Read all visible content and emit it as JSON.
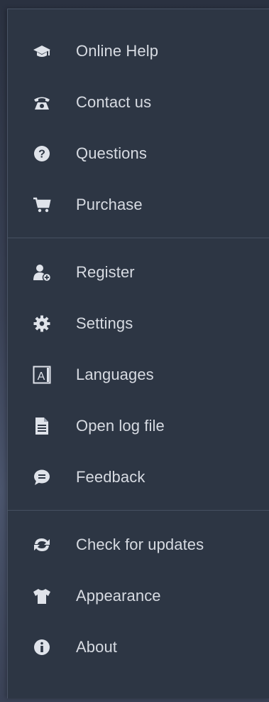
{
  "menu": {
    "groups": [
      {
        "items": [
          {
            "label": "Online Help",
            "icon": "graduation-cap-icon"
          },
          {
            "label": "Contact us",
            "icon": "telephone-icon"
          },
          {
            "label": "Questions",
            "icon": "question-circle-icon"
          },
          {
            "label": "Purchase",
            "icon": "shopping-cart-icon"
          }
        ]
      },
      {
        "items": [
          {
            "label": "Register",
            "icon": "user-add-icon"
          },
          {
            "label": "Settings",
            "icon": "gear-icon"
          },
          {
            "label": "Languages",
            "icon": "language-icon"
          },
          {
            "label": "Open log file",
            "icon": "document-icon"
          },
          {
            "label": "Feedback",
            "icon": "speech-bubble-icon"
          }
        ]
      },
      {
        "items": [
          {
            "label": "Check for updates",
            "icon": "refresh-icon"
          },
          {
            "label": "Appearance",
            "icon": "tshirt-icon"
          },
          {
            "label": "About",
            "icon": "info-circle-icon"
          }
        ]
      }
    ],
    "colors": {
      "background": "#2d3644",
      "text": "#d7dbe2",
      "icon": "#dfe3ea"
    }
  }
}
